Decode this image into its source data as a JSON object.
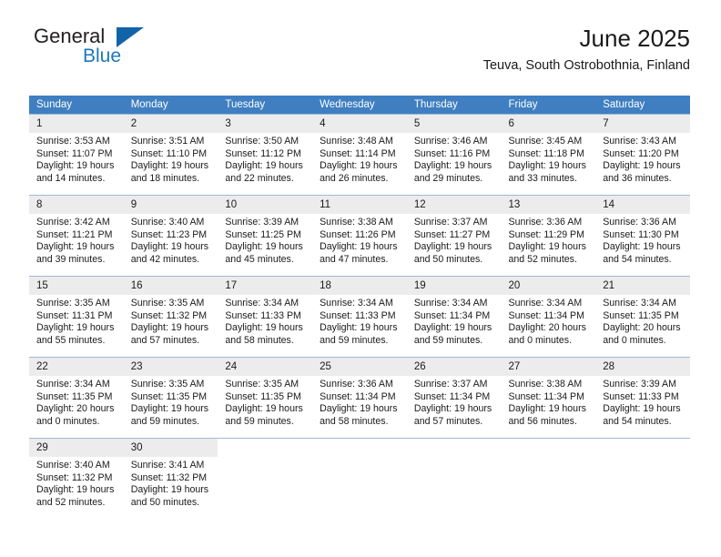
{
  "brand": {
    "name_top": "General",
    "name_bottom": "Blue",
    "accent_color": "#1363a8",
    "text_color": "#1f77bd"
  },
  "header": {
    "title": "June 2025",
    "subtitle": "Teuva, South Ostrobothnia, Finland"
  },
  "theme": {
    "header_bg": "#3f7fc1",
    "header_text": "#ffffff",
    "daynum_bg": "#ececec",
    "grid_line": "#9fb9d6"
  },
  "weekdays": [
    "Sunday",
    "Monday",
    "Tuesday",
    "Wednesday",
    "Thursday",
    "Friday",
    "Saturday"
  ],
  "labels": {
    "sunrise": "Sunrise:",
    "sunset": "Sunset:",
    "daylight": "Daylight:"
  },
  "weeks": [
    [
      {
        "day": "1",
        "sunrise": "Sunrise: 3:53 AM",
        "sunset": "Sunset: 11:07 PM",
        "daylight1": "Daylight: 19 hours",
        "daylight2": "and 14 minutes."
      },
      {
        "day": "2",
        "sunrise": "Sunrise: 3:51 AM",
        "sunset": "Sunset: 11:10 PM",
        "daylight1": "Daylight: 19 hours",
        "daylight2": "and 18 minutes."
      },
      {
        "day": "3",
        "sunrise": "Sunrise: 3:50 AM",
        "sunset": "Sunset: 11:12 PM",
        "daylight1": "Daylight: 19 hours",
        "daylight2": "and 22 minutes."
      },
      {
        "day": "4",
        "sunrise": "Sunrise: 3:48 AM",
        "sunset": "Sunset: 11:14 PM",
        "daylight1": "Daylight: 19 hours",
        "daylight2": "and 26 minutes."
      },
      {
        "day": "5",
        "sunrise": "Sunrise: 3:46 AM",
        "sunset": "Sunset: 11:16 PM",
        "daylight1": "Daylight: 19 hours",
        "daylight2": "and 29 minutes."
      },
      {
        "day": "6",
        "sunrise": "Sunrise: 3:45 AM",
        "sunset": "Sunset: 11:18 PM",
        "daylight1": "Daylight: 19 hours",
        "daylight2": "and 33 minutes."
      },
      {
        "day": "7",
        "sunrise": "Sunrise: 3:43 AM",
        "sunset": "Sunset: 11:20 PM",
        "daylight1": "Daylight: 19 hours",
        "daylight2": "and 36 minutes."
      }
    ],
    [
      {
        "day": "8",
        "sunrise": "Sunrise: 3:42 AM",
        "sunset": "Sunset: 11:21 PM",
        "daylight1": "Daylight: 19 hours",
        "daylight2": "and 39 minutes."
      },
      {
        "day": "9",
        "sunrise": "Sunrise: 3:40 AM",
        "sunset": "Sunset: 11:23 PM",
        "daylight1": "Daylight: 19 hours",
        "daylight2": "and 42 minutes."
      },
      {
        "day": "10",
        "sunrise": "Sunrise: 3:39 AM",
        "sunset": "Sunset: 11:25 PM",
        "daylight1": "Daylight: 19 hours",
        "daylight2": "and 45 minutes."
      },
      {
        "day": "11",
        "sunrise": "Sunrise: 3:38 AM",
        "sunset": "Sunset: 11:26 PM",
        "daylight1": "Daylight: 19 hours",
        "daylight2": "and 47 minutes."
      },
      {
        "day": "12",
        "sunrise": "Sunrise: 3:37 AM",
        "sunset": "Sunset: 11:27 PM",
        "daylight1": "Daylight: 19 hours",
        "daylight2": "and 50 minutes."
      },
      {
        "day": "13",
        "sunrise": "Sunrise: 3:36 AM",
        "sunset": "Sunset: 11:29 PM",
        "daylight1": "Daylight: 19 hours",
        "daylight2": "and 52 minutes."
      },
      {
        "day": "14",
        "sunrise": "Sunrise: 3:36 AM",
        "sunset": "Sunset: 11:30 PM",
        "daylight1": "Daylight: 19 hours",
        "daylight2": "and 54 minutes."
      }
    ],
    [
      {
        "day": "15",
        "sunrise": "Sunrise: 3:35 AM",
        "sunset": "Sunset: 11:31 PM",
        "daylight1": "Daylight: 19 hours",
        "daylight2": "and 55 minutes."
      },
      {
        "day": "16",
        "sunrise": "Sunrise: 3:35 AM",
        "sunset": "Sunset: 11:32 PM",
        "daylight1": "Daylight: 19 hours",
        "daylight2": "and 57 minutes."
      },
      {
        "day": "17",
        "sunrise": "Sunrise: 3:34 AM",
        "sunset": "Sunset: 11:33 PM",
        "daylight1": "Daylight: 19 hours",
        "daylight2": "and 58 minutes."
      },
      {
        "day": "18",
        "sunrise": "Sunrise: 3:34 AM",
        "sunset": "Sunset: 11:33 PM",
        "daylight1": "Daylight: 19 hours",
        "daylight2": "and 59 minutes."
      },
      {
        "day": "19",
        "sunrise": "Sunrise: 3:34 AM",
        "sunset": "Sunset: 11:34 PM",
        "daylight1": "Daylight: 19 hours",
        "daylight2": "and 59 minutes."
      },
      {
        "day": "20",
        "sunrise": "Sunrise: 3:34 AM",
        "sunset": "Sunset: 11:34 PM",
        "daylight1": "Daylight: 20 hours",
        "daylight2": "and 0 minutes."
      },
      {
        "day": "21",
        "sunrise": "Sunrise: 3:34 AM",
        "sunset": "Sunset: 11:35 PM",
        "daylight1": "Daylight: 20 hours",
        "daylight2": "and 0 minutes."
      }
    ],
    [
      {
        "day": "22",
        "sunrise": "Sunrise: 3:34 AM",
        "sunset": "Sunset: 11:35 PM",
        "daylight1": "Daylight: 20 hours",
        "daylight2": "and 0 minutes."
      },
      {
        "day": "23",
        "sunrise": "Sunrise: 3:35 AM",
        "sunset": "Sunset: 11:35 PM",
        "daylight1": "Daylight: 19 hours",
        "daylight2": "and 59 minutes."
      },
      {
        "day": "24",
        "sunrise": "Sunrise: 3:35 AM",
        "sunset": "Sunset: 11:35 PM",
        "daylight1": "Daylight: 19 hours",
        "daylight2": "and 59 minutes."
      },
      {
        "day": "25",
        "sunrise": "Sunrise: 3:36 AM",
        "sunset": "Sunset: 11:34 PM",
        "daylight1": "Daylight: 19 hours",
        "daylight2": "and 58 minutes."
      },
      {
        "day": "26",
        "sunrise": "Sunrise: 3:37 AM",
        "sunset": "Sunset: 11:34 PM",
        "daylight1": "Daylight: 19 hours",
        "daylight2": "and 57 minutes."
      },
      {
        "day": "27",
        "sunrise": "Sunrise: 3:38 AM",
        "sunset": "Sunset: 11:34 PM",
        "daylight1": "Daylight: 19 hours",
        "daylight2": "and 56 minutes."
      },
      {
        "day": "28",
        "sunrise": "Sunrise: 3:39 AM",
        "sunset": "Sunset: 11:33 PM",
        "daylight1": "Daylight: 19 hours",
        "daylight2": "and 54 minutes."
      }
    ],
    [
      {
        "day": "29",
        "sunrise": "Sunrise: 3:40 AM",
        "sunset": "Sunset: 11:32 PM",
        "daylight1": "Daylight: 19 hours",
        "daylight2": "and 52 minutes."
      },
      {
        "day": "30",
        "sunrise": "Sunrise: 3:41 AM",
        "sunset": "Sunset: 11:32 PM",
        "daylight1": "Daylight: 19 hours",
        "daylight2": "and 50 minutes."
      },
      {
        "day": "",
        "sunrise": "",
        "sunset": "",
        "daylight1": "",
        "daylight2": ""
      },
      {
        "day": "",
        "sunrise": "",
        "sunset": "",
        "daylight1": "",
        "daylight2": ""
      },
      {
        "day": "",
        "sunrise": "",
        "sunset": "",
        "daylight1": "",
        "daylight2": ""
      },
      {
        "day": "",
        "sunrise": "",
        "sunset": "",
        "daylight1": "",
        "daylight2": ""
      },
      {
        "day": "",
        "sunrise": "",
        "sunset": "",
        "daylight1": "",
        "daylight2": ""
      }
    ]
  ]
}
